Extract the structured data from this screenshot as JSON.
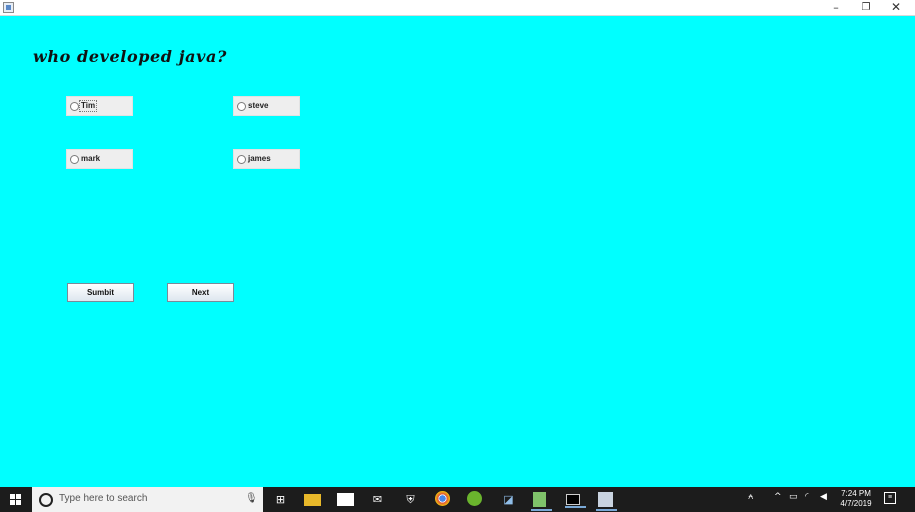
{
  "window": {
    "min_icon": "–",
    "restore_icon": "❐",
    "close_icon": "✕"
  },
  "quiz": {
    "question": "who developed java?",
    "options": [
      "Tim",
      "steve",
      "mark",
      "james"
    ],
    "submit_label": "Sumbit",
    "next_label": "Next"
  },
  "taskbar": {
    "search_placeholder": "Type here to search",
    "icons": [
      "task-view-icon",
      "file-explorer-icon",
      "store-icon",
      "mail-icon",
      "security-icon",
      "chrome-icon",
      "utorrent-icon",
      "app-icon",
      "notepad-icon",
      "terminal-icon",
      "java-icon"
    ],
    "time": "7:24 PM",
    "date": "4/7/2019"
  },
  "colors": {
    "background": "#00ffff",
    "taskbar": "#1c1c1c"
  }
}
